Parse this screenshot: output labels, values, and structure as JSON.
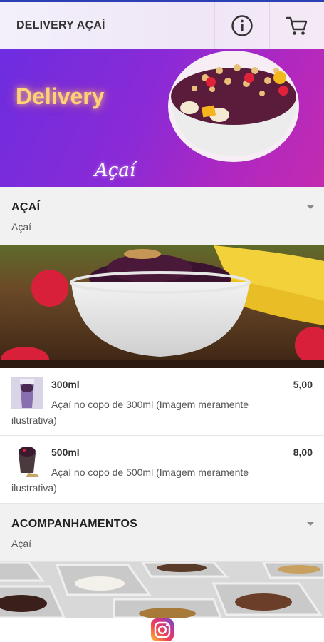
{
  "header": {
    "title": "DELIVERY AÇAÍ",
    "info_icon": "info-icon",
    "cart_icon": "cart-icon"
  },
  "banner": {
    "line1": "Delivery",
    "line2": "Açaí"
  },
  "sections": [
    {
      "title": "AÇAÍ",
      "subtitle": "Açaí",
      "items": [
        {
          "name": "300ml",
          "price": "5,00",
          "description": "Açaí no copo de 300ml (Imagem meramente ilustrativa)"
        },
        {
          "name": "500ml",
          "price": "8,00",
          "description": "Açaí no copo de 500ml (Imagem meramente ilustrativa)"
        }
      ]
    },
    {
      "title": "ACOMPANHAMENTOS",
      "subtitle": "Açaí",
      "items": []
    }
  ],
  "footer": {
    "icon": "instagram-icon"
  },
  "colors": {
    "banner_start": "#6d2de0",
    "banner_end": "#c32bb0",
    "accent_text": "#ffd27a"
  }
}
